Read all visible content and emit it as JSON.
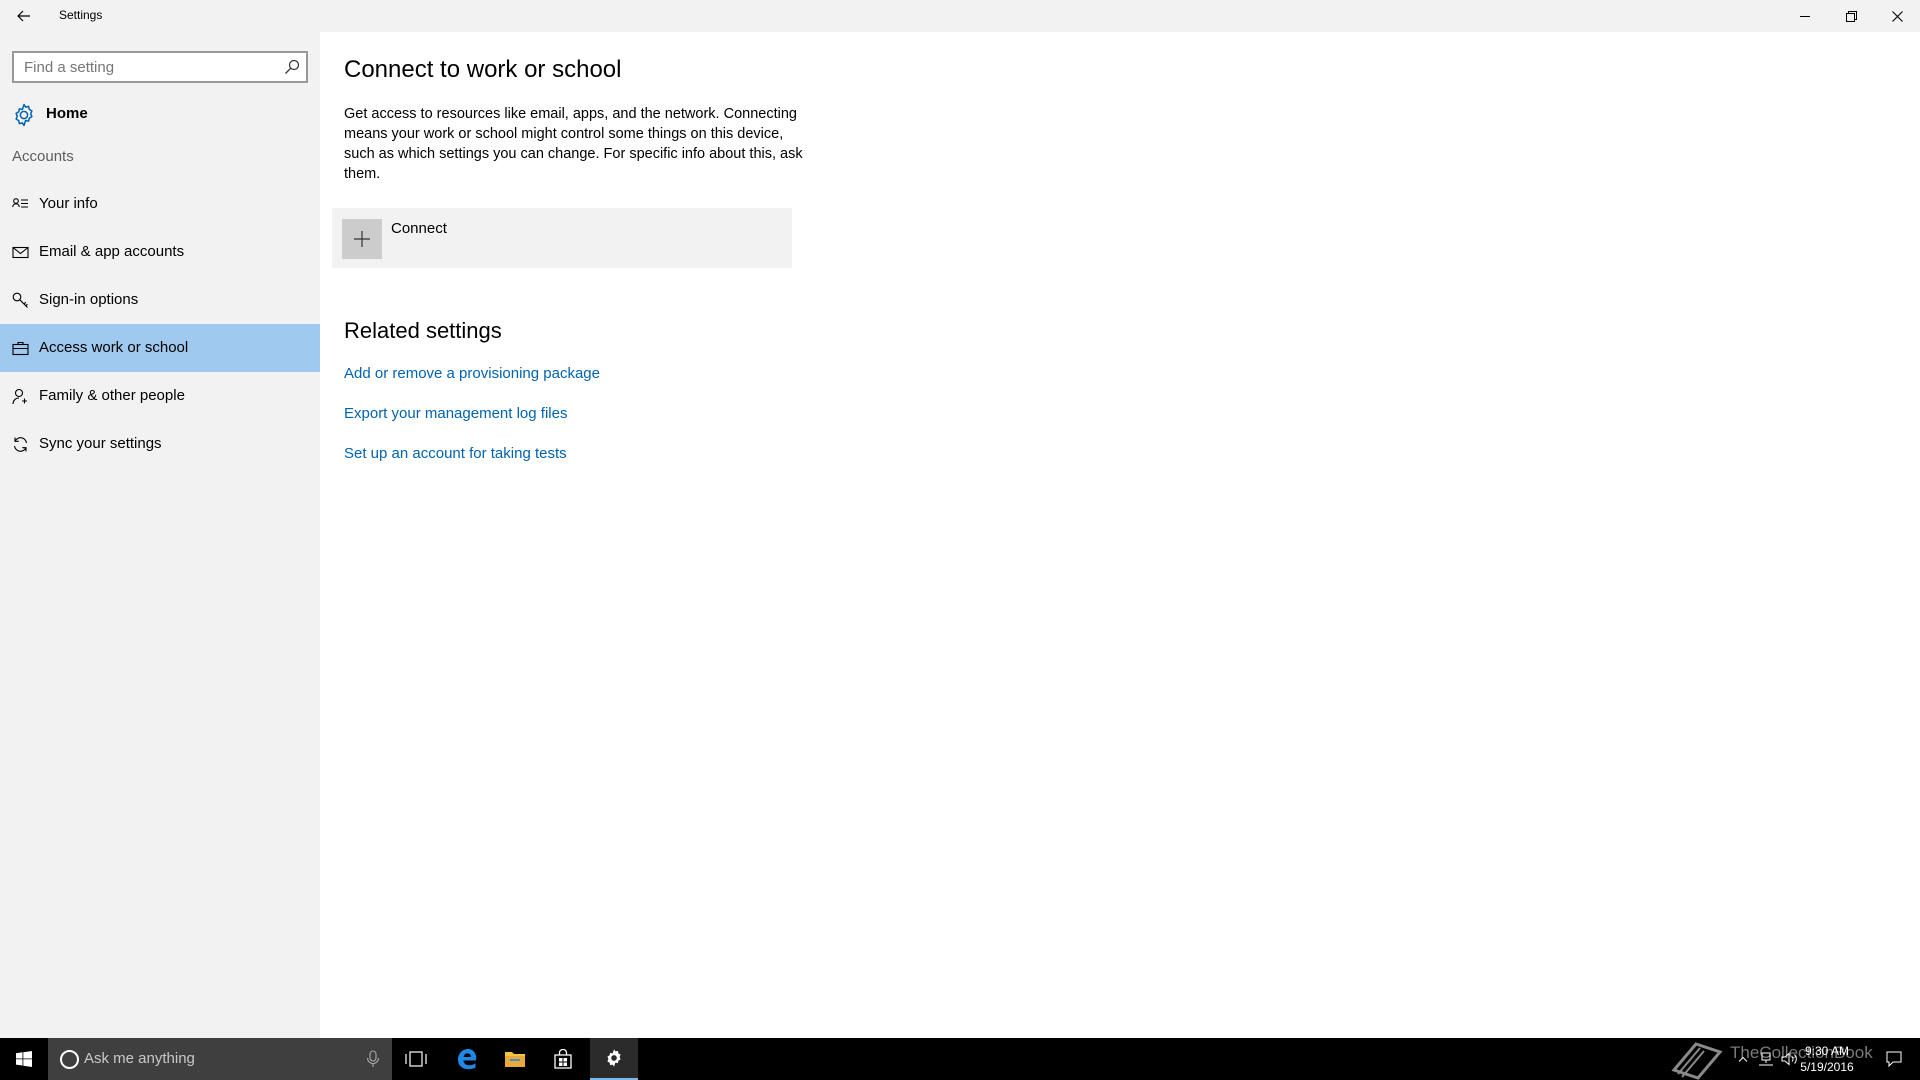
{
  "window": {
    "title": "Settings"
  },
  "sidebar": {
    "search_placeholder": "Find a setting",
    "home_label": "Home",
    "section_label": "Accounts",
    "items": [
      {
        "label": "Your info"
      },
      {
        "label": "Email & app accounts"
      },
      {
        "label": "Sign-in options"
      },
      {
        "label": "Access work or school",
        "selected": true
      },
      {
        "label": "Family & other people"
      },
      {
        "label": "Sync your settings"
      }
    ]
  },
  "main": {
    "title": "Connect to work or school",
    "description": "Get access to resources like email, apps, and the network. Connecting means your work or school might control some things on this device, such as which settings you can change. For specific info about this, ask them.",
    "connect_label": "Connect",
    "related_title": "Related settings",
    "related_links": [
      "Add or remove a provisioning package",
      "Export your management log files",
      "Set up an account for taking tests"
    ]
  },
  "taskbar": {
    "search_placeholder": "Ask me anything",
    "time": "9:30 AM",
    "date": "5/19/2016"
  },
  "watermark": "TheCollectionBook",
  "colors": {
    "accent": "#0063b1",
    "selected_bg": "#9fc9ee",
    "sidebar_bg": "#f2f2f2",
    "taskbar_bg": "#000000"
  }
}
